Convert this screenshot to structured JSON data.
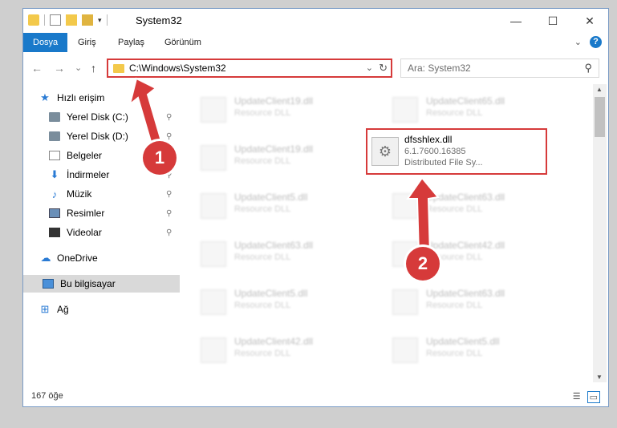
{
  "window": {
    "title": "System32",
    "controls": {
      "minimize": "—",
      "maximize": "☐",
      "close": "✕"
    }
  },
  "ribbon": {
    "tabs": [
      {
        "label": "Dosya",
        "active": true
      },
      {
        "label": "Giriş"
      },
      {
        "label": "Paylaş"
      },
      {
        "label": "Görünüm"
      }
    ],
    "expand_icon": "chevron-down-icon",
    "help_label": "?"
  },
  "navigation": {
    "back": "←",
    "forward": "→",
    "recent": "⌄",
    "up": "↑",
    "address": "C:\\Windows\\System32",
    "address_dropdown": "⌄",
    "refresh": "↻",
    "search_placeholder": "Ara: System32",
    "search_icon": "⚲"
  },
  "sidebar": {
    "quick_access": "Hızlı erişim",
    "items": [
      {
        "label": "Yerel Disk (C:)",
        "pinned": true
      },
      {
        "label": "Yerel Disk (D:)",
        "pinned": true
      },
      {
        "label": "Belgeler",
        "pinned": true
      },
      {
        "label": "İndirmeler",
        "pinned": true
      },
      {
        "label": "Müzik",
        "pinned": true
      },
      {
        "label": "Resimler",
        "pinned": true
      },
      {
        "label": "Videolar",
        "pinned": true
      }
    ],
    "onedrive": "OneDrive",
    "this_pc": "Bu bilgisayar",
    "network": "Ağ",
    "pin_glyph": "📌"
  },
  "files": {
    "left_column": [
      {
        "name": "UpdateClient19.dll",
        "desc": "Resource DLL"
      },
      {
        "name": "UpdateClient19.dll",
        "desc": "Resource DLL"
      },
      {
        "name": "UpdateClient5.dll",
        "desc": "Resource DLL"
      },
      {
        "name": "UpdateClient63.dll",
        "desc": "Resource DLL"
      },
      {
        "name": "UpdateClient5.dll",
        "desc": "Resource DLL"
      },
      {
        "name": "UpdateClient42.dll",
        "desc": "Resource DLL"
      }
    ],
    "right_column": [
      {
        "name": "UpdateClient65.dll",
        "desc": "Resource DLL"
      },
      {
        "name": "UpdateClient63.dll",
        "desc": "Resource DLL"
      },
      {
        "name": "UpdateClient42.dll",
        "desc": "Resource DLL"
      },
      {
        "name": "UpdateClient63.dll",
        "desc": "Resource DLL"
      },
      {
        "name": "UpdateClient5.dll",
        "desc": "Resource DLL"
      }
    ],
    "highlighted": {
      "name": "dfsshlex.dll",
      "version": "6.1.7600.16385",
      "description": "Distributed File Sy..."
    }
  },
  "status": {
    "item_count": "167 öğe"
  },
  "callouts": {
    "step1": "1",
    "step2": "2"
  },
  "colors": {
    "accent": "#1979ca",
    "callout_red": "#d63a3a"
  }
}
